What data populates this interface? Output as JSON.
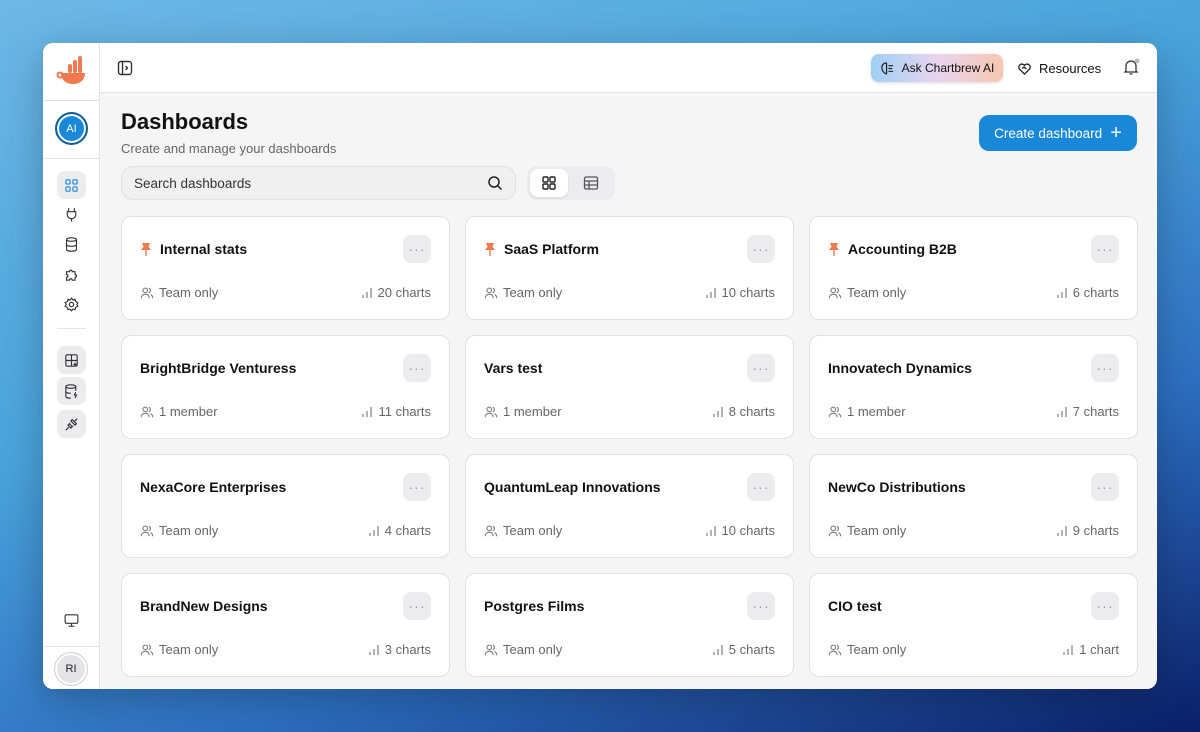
{
  "header": {
    "ask_ai": "Ask Chartbrew AI",
    "resources": "Resources"
  },
  "sidebar": {
    "team_initials": "AI",
    "user_initials": "RI"
  },
  "page": {
    "title": "Dashboards",
    "subtitle": "Create and manage your dashboards",
    "create_label": "Create dashboard",
    "search_placeholder": "Search dashboards"
  },
  "colors": {
    "accent": "#1a88d9",
    "pin": "#f07a4f"
  },
  "dashboards": [
    {
      "name": "Internal stats",
      "pinned": true,
      "access": "Team only",
      "charts": "20 charts"
    },
    {
      "name": "SaaS Platform",
      "pinned": true,
      "access": "Team only",
      "charts": "10 charts"
    },
    {
      "name": "Accounting B2B",
      "pinned": true,
      "access": "Team only",
      "charts": "6 charts"
    },
    {
      "name": "BrightBridge Venturess",
      "pinned": false,
      "access": "1 member",
      "charts": "11 charts"
    },
    {
      "name": "Vars test",
      "pinned": false,
      "access": "1 member",
      "charts": "8 charts"
    },
    {
      "name": "Innovatech Dynamics",
      "pinned": false,
      "access": "1 member",
      "charts": "7 charts"
    },
    {
      "name": "NexaCore Enterprises",
      "pinned": false,
      "access": "Team only",
      "charts": "4 charts"
    },
    {
      "name": "QuantumLeap Innovations",
      "pinned": false,
      "access": "Team only",
      "charts": "10 charts"
    },
    {
      "name": "NewCo Distributions",
      "pinned": false,
      "access": "Team only",
      "charts": "9 charts"
    },
    {
      "name": "BrandNew Designs",
      "pinned": false,
      "access": "Team only",
      "charts": "3 charts"
    },
    {
      "name": "Postgres Films",
      "pinned": false,
      "access": "Team only",
      "charts": "5 charts"
    },
    {
      "name": "CIO test",
      "pinned": false,
      "access": "Team only",
      "charts": "1 chart"
    }
  ]
}
